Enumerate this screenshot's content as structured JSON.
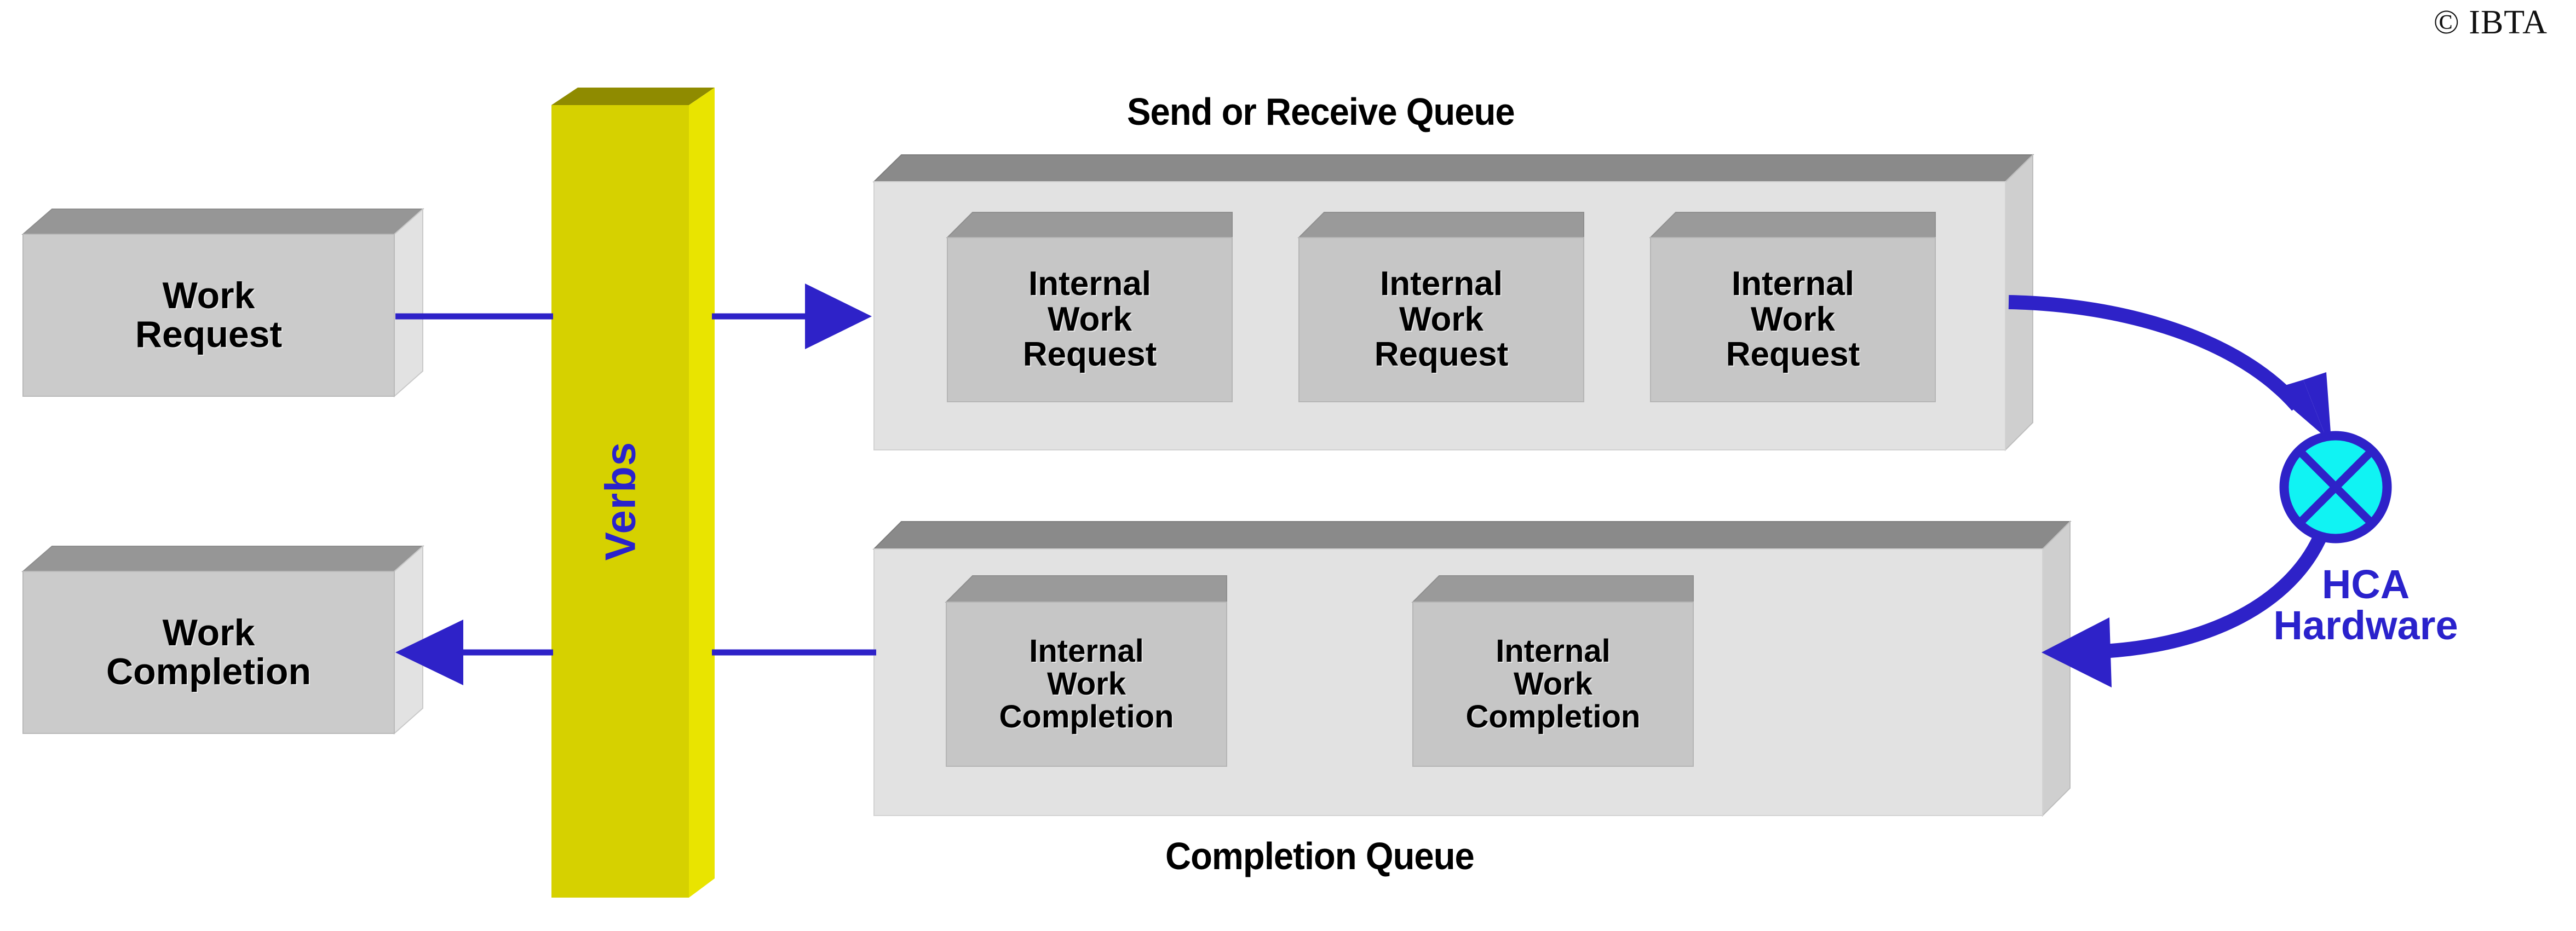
{
  "copyright": "© IBTA",
  "colors": {
    "arrow_blue": "#2e22c8",
    "box_front": "#cbcbcb",
    "box_top": "#969696",
    "box_side": "#e2e2e2",
    "queue_front": "#e2e2e2",
    "queue_top": "#8a8a8a",
    "queue_side": "#cfcfcf",
    "verbs_front": "#d6d100",
    "verbs_top": "#8f8b00",
    "verbs_side": "#e9e400",
    "hca_cyan": "#10f3f3",
    "label_blue": "#2a22cc",
    "text_black": "#000000"
  },
  "left_column": {
    "work_request": {
      "label_line1": "Work",
      "label_line2": "Request"
    },
    "work_completion": {
      "label_line1": "Work",
      "label_line2": "Completion"
    }
  },
  "verbs": {
    "label": "Verbs",
    "icon": "vertical-bar-3d"
  },
  "send_receive_queue": {
    "title": "Send or Receive Queue",
    "items": [
      {
        "line1": "Internal",
        "line2": "Work",
        "line3": "Request"
      },
      {
        "line1": "Internal",
        "line2": "Work",
        "line3": "Request"
      },
      {
        "line1": "Internal",
        "line2": "Work",
        "line3": "Request"
      }
    ]
  },
  "completion_queue": {
    "title": "Completion Queue",
    "items": [
      {
        "line1": "Internal",
        "line2": "Work",
        "line3": "Completion"
      },
      {
        "line1": "Internal",
        "line2": "Work",
        "line3": "Completion"
      }
    ]
  },
  "hca": {
    "label_line1": "HCA",
    "label_line2": "Hardware",
    "icon": "crossed-circle-switch-icon"
  },
  "connectors": [
    {
      "name": "work-request-to-verbs",
      "style": "straight-line",
      "direction": "right"
    },
    {
      "name": "verbs-to-send-receive-queue",
      "style": "arrow",
      "direction": "right"
    },
    {
      "name": "send-receive-queue-to-hca",
      "style": "curved-arrow",
      "direction": "right-down"
    },
    {
      "name": "hca-to-completion-queue",
      "style": "curved-arrow",
      "direction": "left"
    },
    {
      "name": "completion-queue-to-verbs",
      "style": "straight-line",
      "direction": "left"
    },
    {
      "name": "verbs-to-work-completion",
      "style": "arrow",
      "direction": "left"
    }
  ]
}
